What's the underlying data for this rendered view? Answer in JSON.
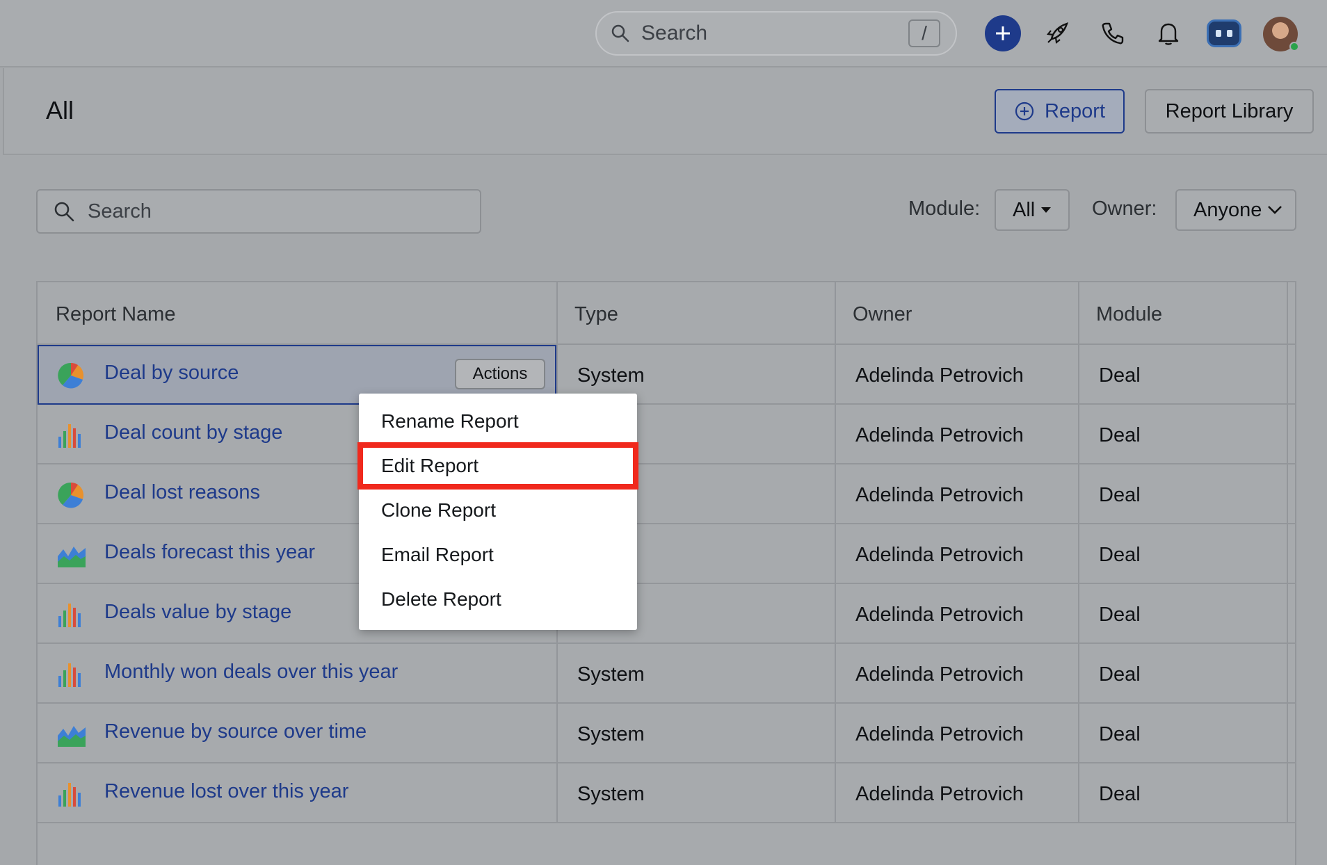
{
  "topbar": {
    "search_placeholder": "Search",
    "search_shortcut": "/",
    "icons": [
      "plus-icon",
      "rocket-icon",
      "phone-icon",
      "bell-icon",
      "bot-icon",
      "avatar"
    ]
  },
  "header": {
    "title": "All",
    "report_button": "Report",
    "library_button": "Report Library"
  },
  "filters": {
    "search_placeholder": "Search",
    "module_label": "Module:",
    "module_value": "All",
    "owner_label": "Owner:",
    "owner_value": "Anyone"
  },
  "table": {
    "columns": [
      "Report Name",
      "Type",
      "Owner",
      "Module"
    ],
    "actions_label": "Actions",
    "rows": [
      {
        "name": "Deal by source",
        "icon": "pie",
        "type": "System",
        "owner": "Adelinda Petrovich",
        "module": "Deal"
      },
      {
        "name": "Deal count by stage",
        "icon": "bar",
        "type": "",
        "owner": "Adelinda Petrovich",
        "module": "Deal"
      },
      {
        "name": "Deal lost reasons",
        "icon": "pie",
        "type": "",
        "owner": "Adelinda Petrovich",
        "module": "Deal"
      },
      {
        "name": "Deals forecast this year",
        "icon": "area",
        "type": "",
        "owner": "Adelinda Petrovich",
        "module": "Deal"
      },
      {
        "name": "Deals value by stage",
        "icon": "bar",
        "type": "",
        "owner": "Adelinda Petrovich",
        "module": "Deal"
      },
      {
        "name": "Monthly won deals over this year",
        "icon": "bar",
        "type": "System",
        "owner": "Adelinda Petrovich",
        "module": "Deal"
      },
      {
        "name": "Revenue by source over time",
        "icon": "area",
        "type": "System",
        "owner": "Adelinda Petrovich",
        "module": "Deal"
      },
      {
        "name": "Revenue lost over this year",
        "icon": "bar",
        "type": "System",
        "owner": "Adelinda Petrovich",
        "module": "Deal"
      }
    ]
  },
  "actions_menu": {
    "items": [
      "Rename Report",
      "Edit Report",
      "Clone Report",
      "Email Report",
      "Delete Report"
    ],
    "highlighted": "Edit Report",
    "highlight_color": "#f0291d"
  }
}
